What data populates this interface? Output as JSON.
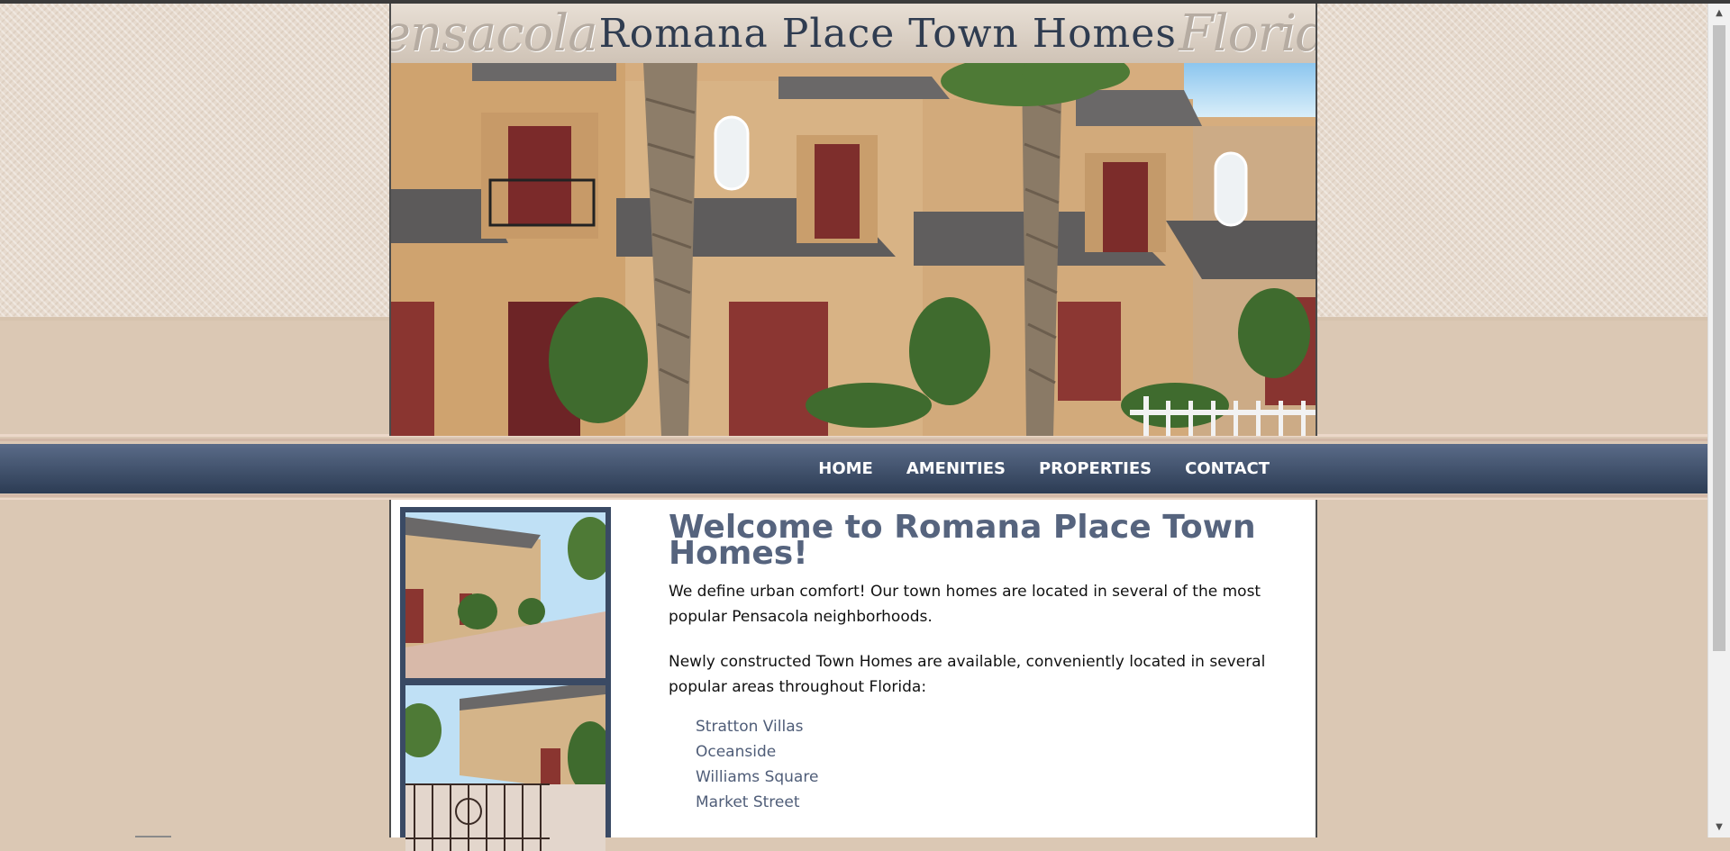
{
  "header": {
    "title_left": "Pensacola",
    "title_main": "Romana Place Town Homes",
    "title_right": "Florida"
  },
  "nav": {
    "items": [
      "HOME",
      "AMENITIES",
      "PROPERTIES",
      "CONTACT"
    ]
  },
  "content": {
    "heading": "Welcome to Romana Place Town Homes!",
    "paragraph_1": "We define urban comfort! Our town homes are located in several of the most popular Pensacola neighborhoods.",
    "paragraph_2": "Newly constructed Town Homes are available, conveniently located in several popular areas throughout Florida:",
    "areas": [
      "Stratton Villas",
      "Oceanside",
      "Williams Square",
      "Market Street"
    ]
  },
  "colors": {
    "page_bg": "#dbc8b4",
    "nav_bg": "#3c4c66",
    "heading": "#56647e",
    "link": "#4f5d78"
  }
}
